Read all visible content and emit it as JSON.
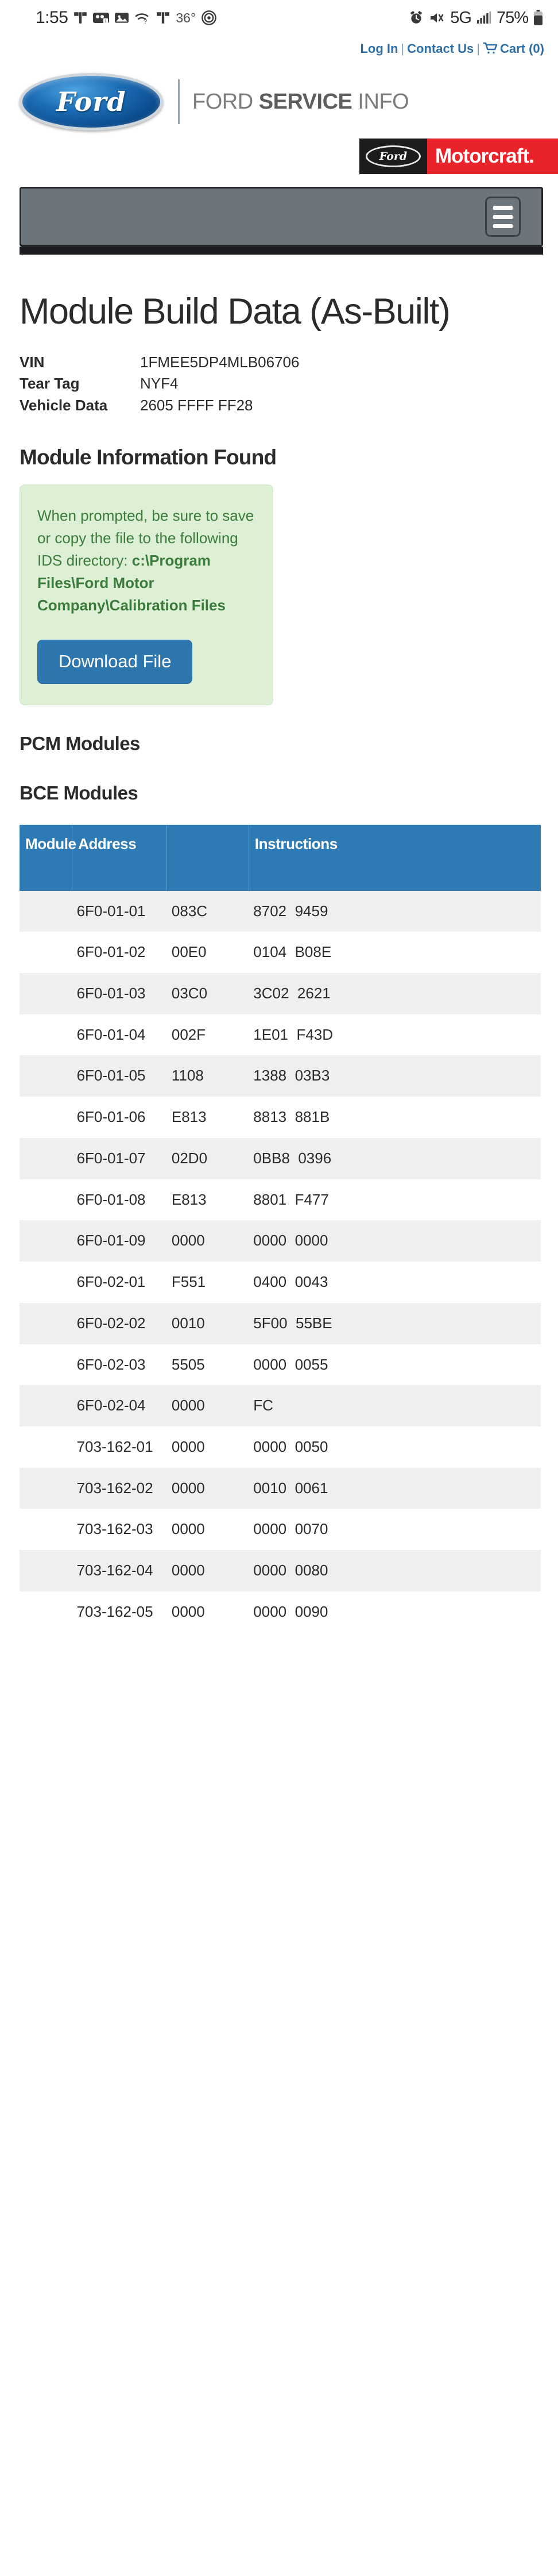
{
  "status_bar": {
    "time": "1:55",
    "temperature": "36°",
    "network": "5G",
    "battery": "75%",
    "left_icons": [
      "tmobile-icon",
      "voicemail-icon",
      "image-icon",
      "wifi-question-icon",
      "tmobile-icon",
      "fingerprint-icon"
    ],
    "right_icons": [
      "alarm-icon",
      "mute-icon",
      "signal-bars-icon",
      "battery-icon"
    ]
  },
  "top_links": {
    "login": "Log In",
    "contact": "Contact Us",
    "cart": "Cart (0)",
    "separator": "|",
    "link_color": "#2f6ea5"
  },
  "brand": {
    "oval_text": "Ford",
    "name_light": "FORD ",
    "name_bold": "SERVICE",
    "name_tail": " INFO"
  },
  "motorcraft": {
    "ford_oval_text": "Ford",
    "label": "Motorcraft.",
    "red": "#e8232a",
    "black": "#1c1c1c"
  },
  "navbar": {
    "menu_icon": "hamburger-icon",
    "bg": "#6d757c"
  },
  "page": {
    "title": "Module Build Data (As-Built)"
  },
  "vehicle": {
    "rows": [
      {
        "label": "VIN",
        "value": "1FMEE5DP4MLB06706"
      },
      {
        "label": "Tear Tag",
        "value": "NYF4"
      },
      {
        "label": "Vehicle Data",
        "value": "2605 FFFF FF28"
      }
    ]
  },
  "module_info": {
    "heading": "Module Information Found",
    "alert_text": "When prompted, be sure to save or copy the file to the following IDS directory:",
    "alert_path": "c:\\Program Files\\Ford Motor Company\\Calibration Files",
    "download_label": "Download File",
    "alert_bg": "#ddf0d6",
    "alert_text_color": "#3b7b3b",
    "button_color": "#2e77ae"
  },
  "sections": {
    "pcm": "PCM Modules",
    "bce": "BCE Modules"
  },
  "table": {
    "header_color": "#2e7ab4",
    "headers": [
      "Module",
      "Address",
      "",
      "Instructions"
    ],
    "rows": [
      {
        "module": "6F0-01-01",
        "h1": "083C",
        "h2": "8702",
        "h3": "9459"
      },
      {
        "module": "6F0-01-02",
        "h1": "00E0",
        "h2": "0104",
        "h3": "B08E"
      },
      {
        "module": "6F0-01-03",
        "h1": "03C0",
        "h2": "3C02",
        "h3": "2621"
      },
      {
        "module": "6F0-01-04",
        "h1": "002F",
        "h2": "1E01",
        "h3": "F43D"
      },
      {
        "module": "6F0-01-05",
        "h1": "1108",
        "h2": "1388",
        "h3": "03B3"
      },
      {
        "module": "6F0-01-06",
        "h1": "E813",
        "h2": "8813",
        "h3": "881B"
      },
      {
        "module": "6F0-01-07",
        "h1": "02D0",
        "h2": "0BB8",
        "h3": "0396"
      },
      {
        "module": "6F0-01-08",
        "h1": "E813",
        "h2": "8801",
        "h3": "F477"
      },
      {
        "module": "6F0-01-09",
        "h1": "0000",
        "h2": "0000",
        "h3": "0000"
      },
      {
        "module": "6F0-02-01",
        "h1": "F551",
        "h2": "0400",
        "h3": "0043"
      },
      {
        "module": "6F0-02-02",
        "h1": "0010",
        "h2": "5F00",
        "h3": "55BE"
      },
      {
        "module": "6F0-02-03",
        "h1": "5505",
        "h2": "0000",
        "h3": "0055"
      },
      {
        "module": "6F0-02-04",
        "h1": "0000",
        "h2": "FC",
        "h3": ""
      },
      {
        "module": "703-162-01",
        "h1": "0000",
        "h2": "0000",
        "h3": "0050"
      },
      {
        "module": "703-162-02",
        "h1": "0000",
        "h2": "0010",
        "h3": "0061"
      },
      {
        "module": "703-162-03",
        "h1": "0000",
        "h2": "0000",
        "h3": "0070"
      },
      {
        "module": "703-162-04",
        "h1": "0000",
        "h2": "0000",
        "h3": "0080"
      },
      {
        "module": "703-162-05",
        "h1": "0000",
        "h2": "0000",
        "h3": "0090"
      }
    ]
  }
}
